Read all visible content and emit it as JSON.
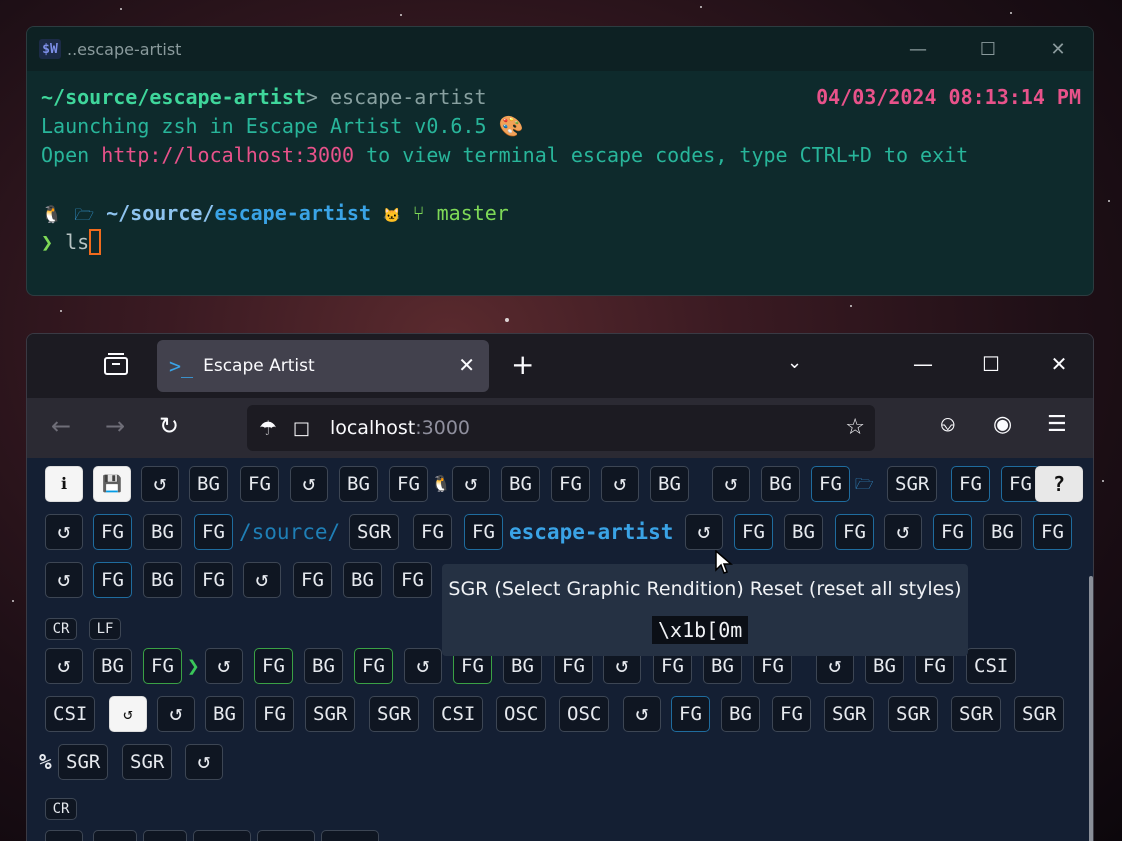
{
  "terminal": {
    "title": "..escape-artist",
    "app_icon_text": "$W",
    "prompt_path": "~/source/escape-artist",
    "prompt_symbol": ">",
    "command": " escape-artist",
    "datetime": "04/03/2024 08:13:14 PM",
    "launch_line": "Launching zsh in Escape Artist v0.6.5 🎨",
    "open_prefix": "Open ",
    "open_url": "http://localhost:3000",
    "open_suffix": " to view terminal escape codes, type CTRL+D to exit",
    "p2_linux": "🐧",
    "p2_folder": "🗁",
    "p2_path_prefix": " ~/source/",
    "p2_path_dir": "escape-artist",
    "p2_git_icon": "🐱",
    "p2_branch_icon": "⑂",
    "p2_branch": " master",
    "input_prompt": "❯",
    "input_text": " ls"
  },
  "browser": {
    "tab_title": "Escape Artist",
    "tab_icon": ">_",
    "url_host": "localhost",
    "url_port": ":3000"
  },
  "page": {
    "row1": [
      "BG",
      "FG",
      "BG",
      "FG",
      "BG",
      "FG",
      "BG",
      "BG",
      "FG",
      "SGR",
      "FG",
      "FG",
      "?"
    ],
    "row1_text": [
      "🐧",
      "🗁"
    ],
    "row2": [
      "FG",
      "BG",
      "FG",
      "SGR",
      "FG",
      "FG",
      "FG",
      "BG",
      "FG",
      "FG",
      "BG",
      "FG"
    ],
    "row2_text": [
      "/source/",
      "escape-artist"
    ],
    "row3": [
      "FG",
      "BG",
      "FG",
      "FG",
      "BG",
      "FG"
    ],
    "cr": "CR",
    "lf": "LF",
    "row4": [
      "BG",
      "FG",
      "FG",
      "BG",
      "FG",
      "FG",
      "BG",
      "FG",
      "FG",
      "BG",
      "FG",
      "BG",
      "FG",
      "CSI"
    ],
    "row4_text": "❯",
    "row5": [
      "CSI",
      "BG",
      "FG",
      "SGR",
      "SGR",
      "CSI",
      "OSC",
      "OSC",
      "FG",
      "BG",
      "FG",
      "SGR",
      "SGR",
      "SGR",
      "SGR"
    ],
    "row6_text": "%",
    "row6": [
      "SGR",
      "SGR"
    ],
    "cr2": "CR",
    "tooltip_title": "SGR (Select Graphic Rendition) Reset (reset all styles)",
    "tooltip_code": "\\x1b[0m"
  }
}
